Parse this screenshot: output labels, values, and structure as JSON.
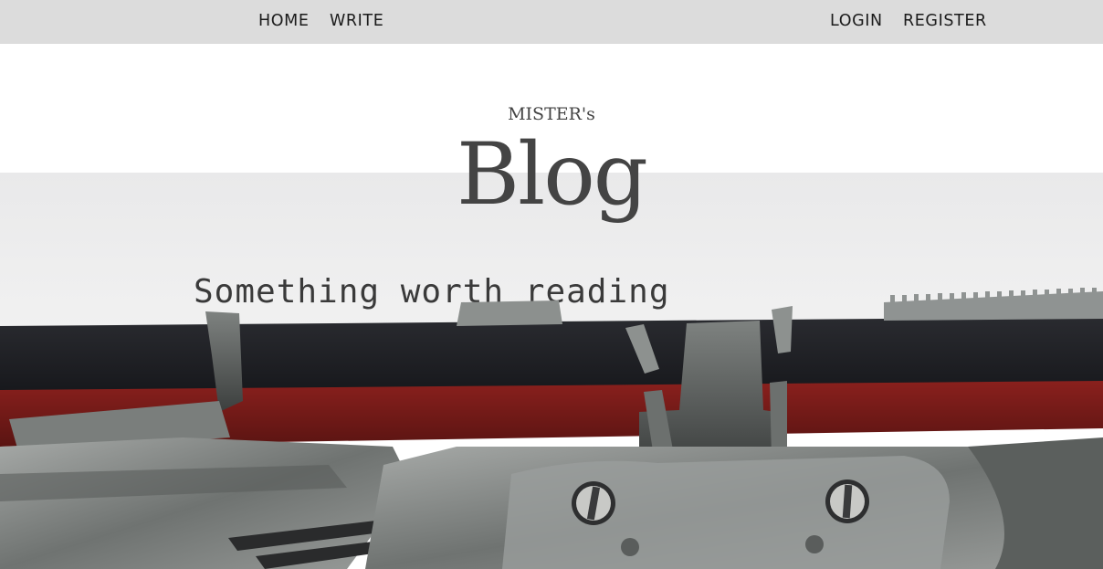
{
  "nav": {
    "home": "HOME",
    "write": "WRITE",
    "login": "LOGIN",
    "register": "REGISTER"
  },
  "header": {
    "subtitle": "MISTER's",
    "title": "Blog"
  },
  "hero": {
    "typed_text": "Something worth reading"
  },
  "colors": {
    "topbar": "#dcdcdc",
    "title_text": "#444444",
    "ribbon_black": "#1e1f24",
    "ribbon_red": "#7a1a18",
    "paper": "#ececec",
    "metal": "#8a8e8c"
  }
}
